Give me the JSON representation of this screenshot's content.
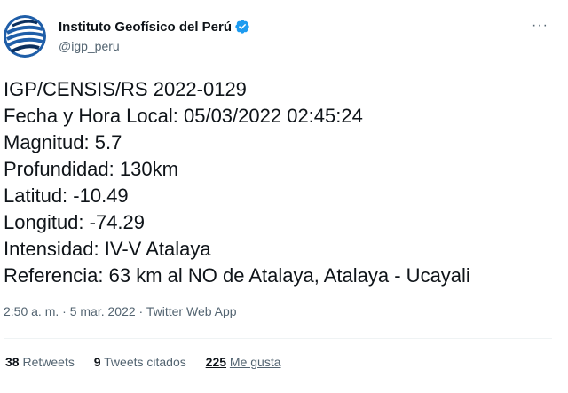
{
  "account": {
    "display_name": "Instituto Geofísico del Perú",
    "handle": "@igp_peru",
    "verified_icon": "verified-badge-icon",
    "avatar_icon": "igp-logo-icon",
    "more_label": "···"
  },
  "tweet": {
    "lines": [
      "IGP/CENSIS/RS 2022-0129",
      "Fecha y Hora Local: 05/03/2022 02:45:24",
      "Magnitud: 5.7",
      "Profundidad: 130km",
      "Latitud: -10.49",
      "Longitud: -74.29",
      "Intensidad: IV-V Atalaya",
      "Referencia: 63 km al NO de Atalaya, Atalaya - Ucayali"
    ]
  },
  "meta": {
    "time": "2:50 a. m.",
    "separator1": " · ",
    "date": "5 mar. 2022",
    "separator2": " · ",
    "source": "Twitter Web App"
  },
  "stats": {
    "retweets_count": "38",
    "retweets_label": "Retweets",
    "quotes_count": "9",
    "quotes_label": "Tweets citados",
    "likes_count": "225",
    "likes_label": "Me gusta"
  },
  "colors": {
    "text": "#0f1419",
    "secondary": "#536471",
    "verified": "#1d9bf0",
    "logo_blue": "#1f5ea8",
    "logo_dark": "#0b2f5e"
  }
}
